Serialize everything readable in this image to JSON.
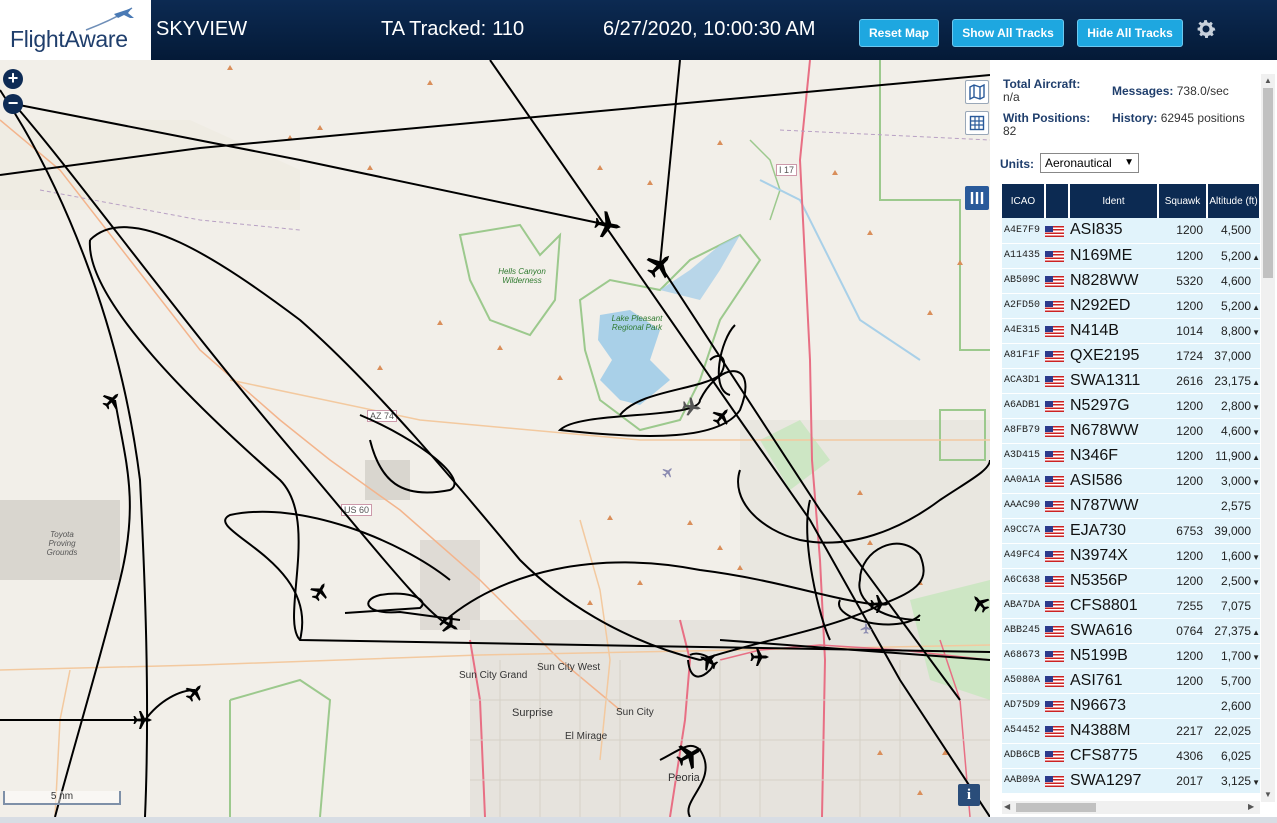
{
  "header": {
    "logo_text": "FlightAware",
    "app_title": "SKYVIEW",
    "tracked_label": "TA Tracked:",
    "tracked_count": "110",
    "datetime": "6/27/2020, 10:00:30 AM",
    "buttons": {
      "reset_map": "Reset Map",
      "show_all_tracks": "Show All Tracks",
      "hide_all_tracks": "Hide All Tracks"
    }
  },
  "map": {
    "zoom_in": "+",
    "zoom_out": "−",
    "scale_label": "5 nm",
    "info_label": "i",
    "labels": {
      "hells_canyon": "Hells Canyon Wilderness",
      "lake_pleasant": "Lake Pleasant Regional Park",
      "toyota": "Toyota Proving Grounds",
      "sun_city_west": "Sun City West",
      "sun_city_grand": "Sun City Grand",
      "surprise": "Surprise",
      "sun_city": "Sun City",
      "el_mirage": "El Mirage",
      "peoria": "Peoria",
      "az74": "AZ 74",
      "us60": "US 60",
      "i17": "I 17"
    }
  },
  "stats": {
    "total_aircraft_label": "Total Aircraft:",
    "total_aircraft_value": "n/a",
    "with_positions_label": "With Positions:",
    "with_positions_value": "82",
    "messages_label": "Messages:",
    "messages_value": "738.0/sec",
    "history_label": "History:",
    "history_value": "62945 positions"
  },
  "units": {
    "label": "Units:",
    "selected": "Aeronautical"
  },
  "table": {
    "headers": {
      "icao": "ICAO",
      "flag": "",
      "ident": "Ident",
      "squawk": "Squawk",
      "altitude": "Altitude (ft)"
    },
    "rows": [
      {
        "icao": "A4E7F9",
        "ident": "ASI835",
        "squawk": "1200",
        "altitude": "4,500",
        "trend": ""
      },
      {
        "icao": "A11435",
        "ident": "N169ME",
        "squawk": "1200",
        "altitude": "5,200",
        "trend": "▲"
      },
      {
        "icao": "AB509C",
        "ident": "N828WW",
        "squawk": "5320",
        "altitude": "4,600",
        "trend": ""
      },
      {
        "icao": "A2FD50",
        "ident": "N292ED",
        "squawk": "1200",
        "altitude": "5,200",
        "trend": "▲"
      },
      {
        "icao": "A4E315",
        "ident": "N414B",
        "squawk": "1014",
        "altitude": "8,800",
        "trend": "▼"
      },
      {
        "icao": "A81F1F",
        "ident": "QXE2195",
        "squawk": "1724",
        "altitude": "37,000",
        "trend": ""
      },
      {
        "icao": "ACA3D1",
        "ident": "SWA1311",
        "squawk": "2616",
        "altitude": "23,175",
        "trend": "▲"
      },
      {
        "icao": "A6ADB1",
        "ident": "N5297G",
        "squawk": "1200",
        "altitude": "2,800",
        "trend": "▼"
      },
      {
        "icao": "A8FB79",
        "ident": "N678WW",
        "squawk": "1200",
        "altitude": "4,600",
        "trend": "▼"
      },
      {
        "icao": "A3D415",
        "ident": "N346F",
        "squawk": "1200",
        "altitude": "11,900",
        "trend": "▲"
      },
      {
        "icao": "AA0A1A",
        "ident": "ASI586",
        "squawk": "1200",
        "altitude": "3,000",
        "trend": "▼"
      },
      {
        "icao": "AAAC90",
        "ident": "N787WW",
        "squawk": "",
        "altitude": "2,575",
        "trend": ""
      },
      {
        "icao": "A9CC7A",
        "ident": "EJA730",
        "squawk": "6753",
        "altitude": "39,000",
        "trend": ""
      },
      {
        "icao": "A49FC4",
        "ident": "N3974X",
        "squawk": "1200",
        "altitude": "1,600",
        "trend": "▼"
      },
      {
        "icao": "A6C638",
        "ident": "N5356P",
        "squawk": "1200",
        "altitude": "2,500",
        "trend": "▼"
      },
      {
        "icao": "ABA7DA",
        "ident": "CFS8801",
        "squawk": "7255",
        "altitude": "7,075",
        "trend": ""
      },
      {
        "icao": "ABB245",
        "ident": "SWA616",
        "squawk": "0764",
        "altitude": "27,375",
        "trend": "▲"
      },
      {
        "icao": "A68673",
        "ident": "N5199B",
        "squawk": "1200",
        "altitude": "1,700",
        "trend": "▼"
      },
      {
        "icao": "A5080A",
        "ident": "ASI761",
        "squawk": "1200",
        "altitude": "5,700",
        "trend": ""
      },
      {
        "icao": "AD75D9",
        "ident": "N96673",
        "squawk": "",
        "altitude": "2,600",
        "trend": ""
      },
      {
        "icao": "A54452",
        "ident": "N4388M",
        "squawk": "2217",
        "altitude": "22,025",
        "trend": ""
      },
      {
        "icao": "ADB6CB",
        "ident": "CFS8775",
        "squawk": "4306",
        "altitude": "6,025",
        "trend": ""
      },
      {
        "icao": "AAB09A",
        "ident": "SWA1297",
        "squawk": "2017",
        "altitude": "3,125",
        "trend": "▼"
      }
    ]
  },
  "colors": {
    "header_bg": "#0c2a52",
    "button_bg": "#1ea7e0",
    "table_row_bg": "#e1f3fb",
    "track_color": "#000000"
  }
}
